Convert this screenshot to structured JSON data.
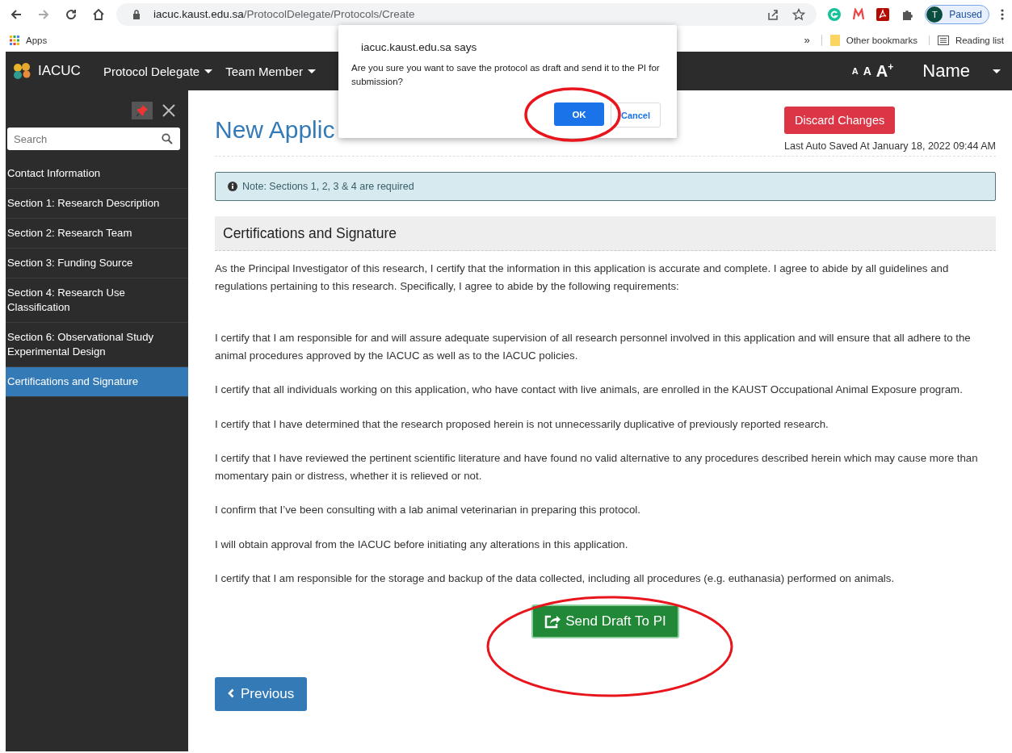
{
  "browser": {
    "url_host": "iacuc.kaust.edu.sa",
    "url_path": "/ProtocolDelegate/Protocols/Create",
    "profile_initial": "T",
    "profile_status": "Paused",
    "bookmarks": [
      {
        "label": "Apps",
        "kind": "apps"
      }
    ],
    "overflow": "»",
    "bookmarks_right": [
      {
        "label": "Other bookmarks",
        "kind": "folder"
      },
      {
        "label": "Reading list",
        "kind": "list"
      }
    ]
  },
  "navbar": {
    "brand": "IACUC",
    "menus": [
      "Protocol Delegate",
      "Team Member"
    ],
    "font_sizes": [
      "A",
      "A",
      "A"
    ],
    "font_plus": "+",
    "user": "Name"
  },
  "sidebar": {
    "search_placeholder": "Search",
    "items": [
      {
        "label": "Contact Information",
        "selected": false
      },
      {
        "label": "Section 1: Research Description",
        "selected": false
      },
      {
        "label": "Section 2: Research Team",
        "selected": false
      },
      {
        "label": "Section 3: Funding Source",
        "selected": false
      },
      {
        "label": "Section 4: Research Use Classification",
        "selected": false
      },
      {
        "label": "Section 6: Observational Study Experimental Design",
        "selected": false
      },
      {
        "label": "Certifications and Signature",
        "selected": true
      }
    ]
  },
  "page": {
    "title": "New Applic",
    "discard_button": "Discard Changes",
    "autosave": "Last Auto Saved At January 18, 2022 09:44 AM",
    "note": "Note: Sections 1, 2, 3 & 4 are required",
    "section_title": "Certifications and Signature",
    "paragraphs": [
      "As the Principal Investigator of this research, I certify that the information in this application is accurate and complete. I agree to abide by all guidelines and regulations pertaining to this research. Specifically, I agree to abide by the following requirements:",
      "I certify that I am responsible for and will assure adequate supervision of all research personnel involved in this application and will ensure that all adhere to the animal procedures approved by the IACUC as well as to the IACUC policies.",
      "I certify that all individuals working on this application, who have contact with live animals, are enrolled in the KAUST Occupational Animal Exposure program.",
      "I certify that I have determined that the research proposed herein is not unnecessarily duplicative of previously reported research.",
      "I certify that I have reviewed the pertinent scientific literature and have found no valid alternative to any procedures described herein which may cause more than momentary pain or distress, whether it is relieved or not.",
      "I confirm that I’ve been consulting with a lab animal veterinarian in preparing this protocol.",
      "I will obtain approval from the IACUC before initiating any alterations in this application.",
      "I certify that I am responsible for the storage and backup of the data collected, including all procedures (e.g. euthanasia) performed on animals."
    ],
    "send_button": "Send Draft To PI",
    "previous_button": "Previous"
  },
  "dialog": {
    "title": "iacuc.kaust.edu.sa says",
    "message": "Are you sure you want to save the protocol as draft and send it to the PI for submission?",
    "ok": "OK",
    "cancel": "Cancel"
  }
}
